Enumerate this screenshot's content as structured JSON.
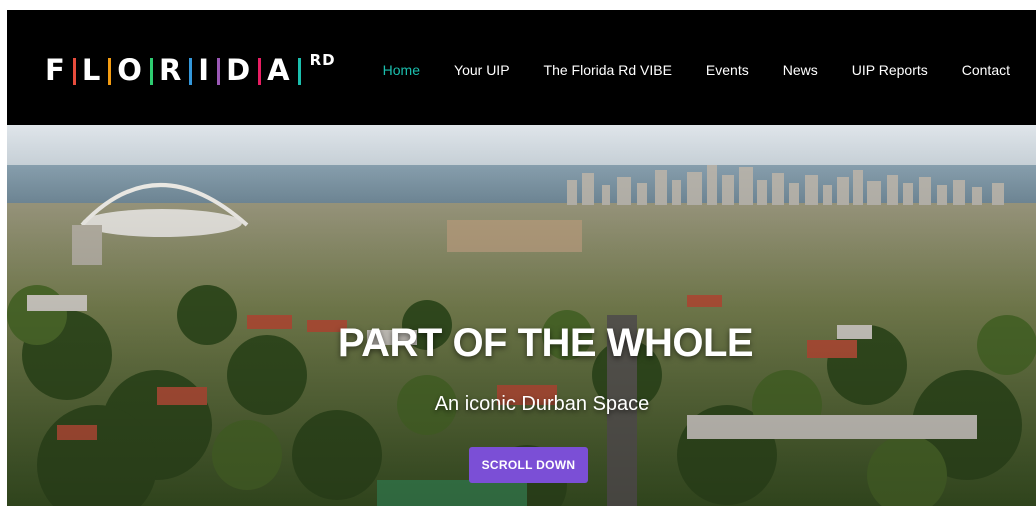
{
  "site": {
    "logo_letters": [
      "F",
      "L",
      "O",
      "R",
      "I",
      "D",
      "A"
    ],
    "logo_suffix": "RD",
    "logo_separator_colors": [
      "#e74c3c",
      "#f39c12",
      "#2ecc71",
      "#3498db",
      "#9b59b6",
      "#e91e63"
    ]
  },
  "nav": {
    "items": [
      {
        "label": "Home",
        "active": true
      },
      {
        "label": "Your UIP",
        "active": false
      },
      {
        "label": "The Florida Rd VIBE",
        "active": false
      },
      {
        "label": "Events",
        "active": false
      },
      {
        "label": "News",
        "active": false
      },
      {
        "label": "UIP Reports",
        "active": false
      },
      {
        "label": "Contact",
        "active": false
      }
    ],
    "active_color": "#1bbfae"
  },
  "hero": {
    "title": "PART OF THE WHOLE",
    "subtitle": "An iconic Durban Space",
    "button_label": "SCROLL DOWN",
    "button_color": "#7b4fd6",
    "image_icon": "aerial-city-photo"
  }
}
